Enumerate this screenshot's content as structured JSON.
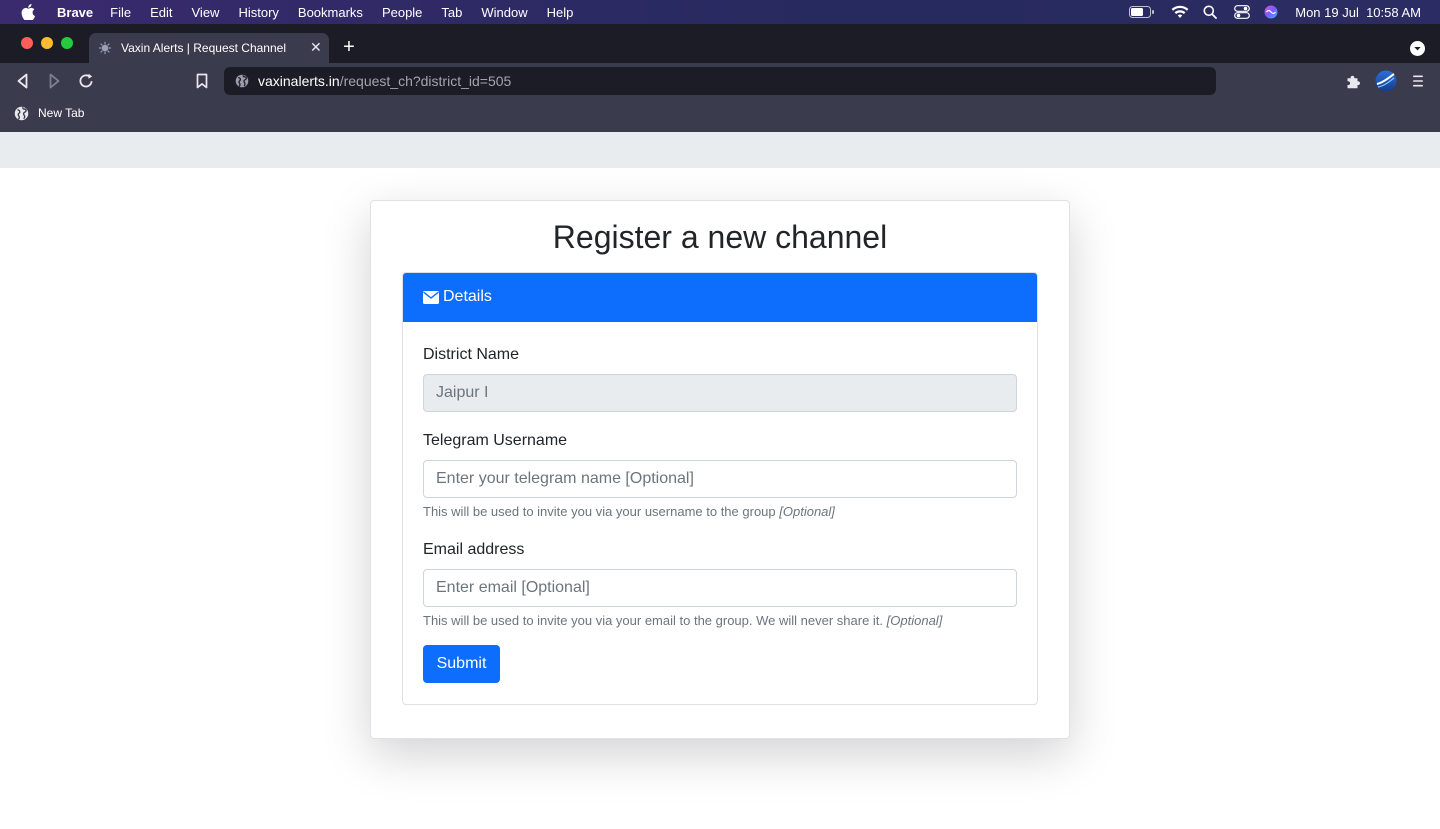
{
  "menubar": {
    "app": "Brave",
    "items": [
      "File",
      "Edit",
      "View",
      "History",
      "Bookmarks",
      "People",
      "Tab",
      "Window",
      "Help"
    ],
    "clock": "Mon 19 Jul  10:58 AM"
  },
  "browser": {
    "tab_title": "Vaxin Alerts | Request Channel",
    "url_host": "vaxinalerts.in",
    "url_path": "/request_ch?district_id=505",
    "bookmark": "New Tab"
  },
  "page": {
    "heading": "Register a new channel",
    "card_header": "Details",
    "district": {
      "label": "District Name",
      "value": "Jaipur I"
    },
    "telegram": {
      "label": "Telegram Username",
      "placeholder": "Enter your telegram name [Optional]",
      "help": "This will be used to invite you via your username to the group",
      "help_tag": "[Optional]"
    },
    "email": {
      "label": "Email address",
      "placeholder": "Enter email [Optional]",
      "help": "This will be used to invite you via your email to the group. We will never share it.",
      "help_tag": "[Optional]"
    },
    "submit": "Submit"
  },
  "colors": {
    "primary": "#0d6efd",
    "tab_strip": "#1c1c27",
    "toolbar": "#3a3b4d"
  }
}
